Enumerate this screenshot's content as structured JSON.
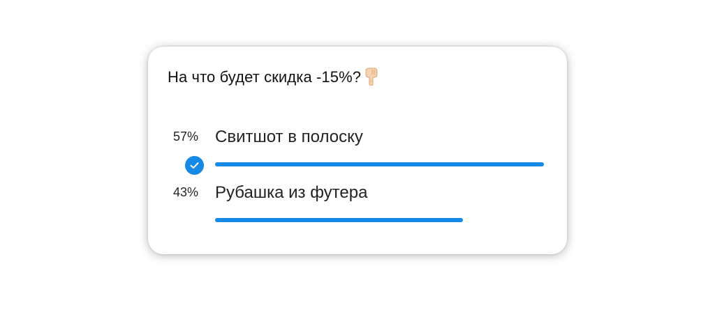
{
  "poll": {
    "question": "На что будет скидка -15%?",
    "question_icon": "pointing-down-hand-icon",
    "accent_color": "#1589e6",
    "options": [
      {
        "percent_label": "57%",
        "label": "Свитшот в полоску",
        "share": 0.57,
        "selected": true,
        "selected_icon": "check-circle-icon"
      },
      {
        "percent_label": "43%",
        "label": "Рубашка из футера",
        "share": 0.43,
        "selected": false
      }
    ]
  }
}
